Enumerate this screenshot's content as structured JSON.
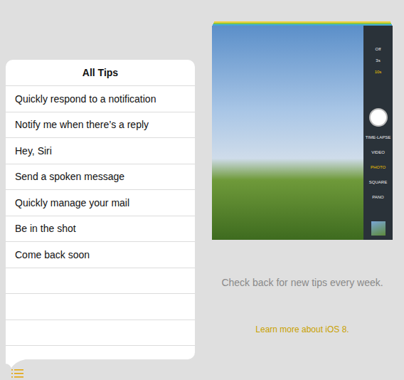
{
  "popover": {
    "title": "All Tips",
    "tips": [
      "Quickly respond to a notification",
      "Notify me when there’s a reply",
      "Hey, Siri",
      "Send a spoken message",
      "Quickly manage your mail",
      "Be in the shot",
      "Come back soon"
    ]
  },
  "card": {
    "camera": {
      "timer": [
        {
          "label": "Off",
          "selected": false
        },
        {
          "label": "3s",
          "selected": false
        },
        {
          "label": "10s",
          "selected": true
        }
      ],
      "modes": [
        {
          "label": "TIME-LAPSE",
          "selected": false
        },
        {
          "label": "VIDEO",
          "selected": false
        },
        {
          "label": "PHOTO",
          "selected": true
        },
        {
          "label": "SQUARE",
          "selected": false
        },
        {
          "label": "PANO",
          "selected": false
        }
      ]
    }
  },
  "message": "Check back for new tips every week.",
  "link": "Learn more about iOS 8."
}
